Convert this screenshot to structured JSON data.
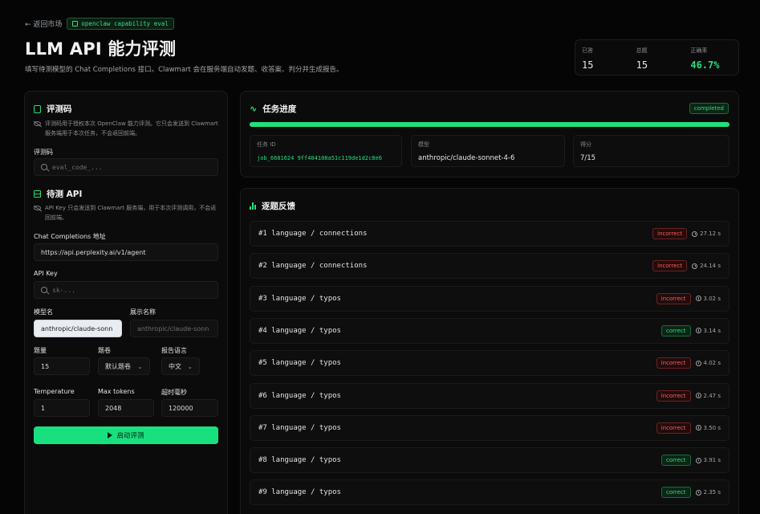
{
  "header": {
    "back_label": "← 返回市场",
    "tag_label": "openclaw capability eval",
    "title": "LLM API 能力评测",
    "description": "填写待测模型的 Chat Completions 接口。Clawmart 会在服务端自动发题、收答案、判分并生成报告。"
  },
  "stats": [
    {
      "label": "已答",
      "value": "15"
    },
    {
      "label": "总题",
      "value": "15"
    },
    {
      "label": "正确率",
      "value": "46.7%"
    }
  ],
  "left": {
    "eval_section": {
      "title": "评测码",
      "note": "评测码用于授权本次 OpenClaw 能力评测。它只会发送到 Clawmart 服务端用于本次任务，不会返回前端。",
      "code_label": "评测码",
      "code_placeholder": "eval_code_..."
    },
    "api_section": {
      "title": "待测 API",
      "note": "API Key 只会发送到 Clawmart 服务端，用于本次评测调用，不会返回前端。",
      "endpoint_label": "Chat Completions 地址",
      "endpoint_value": "https://api.perplexity.ai/v1/agent",
      "key_label": "API Key",
      "key_placeholder": "sk-...",
      "model_label": "模型名",
      "model_value": "anthropic/claude-sonn",
      "display_label": "展示名称",
      "display_placeholder": "anthropic/claude-sonn",
      "count_label": "题量",
      "count_value": "15",
      "set_label": "题卷",
      "set_value": "默认题卷",
      "lang_label": "报告语言",
      "lang_value": "中文",
      "temp_label": "Temperature",
      "temp_value": "1",
      "tokens_label": "Max tokens",
      "tokens_value": "2048",
      "timeout_label": "超时毫秒",
      "timeout_value": "120000",
      "run_label": "启动评测"
    }
  },
  "progress": {
    "title": "任务进度",
    "status": "completed",
    "fraction": 1.0,
    "job_label": "任务 ID",
    "job_value": "job_6681624 9ff404108a51c119de1d2c8e6",
    "model_label": "模型",
    "model_value": "anthropic/claude-sonnet-4-6",
    "score_label": "得分",
    "score_value": "7/15"
  },
  "feedback": {
    "title": "逐题反馈",
    "rows": [
      {
        "q": "#1 language / connections",
        "result": "incorrect",
        "time": "27.12 s"
      },
      {
        "q": "#2 language / connections",
        "result": "incorrect",
        "time": "24.14 s"
      },
      {
        "q": "#3 language / typos",
        "result": "incorrect",
        "time": "3.02 s"
      },
      {
        "q": "#4 language / typos",
        "result": "correct",
        "time": "3.14 s"
      },
      {
        "q": "#5 language / typos",
        "result": "incorrect",
        "time": "4.02 s"
      },
      {
        "q": "#6 language / typos",
        "result": "incorrect",
        "time": "2.47 s"
      },
      {
        "q": "#7 language / typos",
        "result": "incorrect",
        "time": "3.50 s"
      },
      {
        "q": "#8 language / typos",
        "result": "correct",
        "time": "3.91 s"
      },
      {
        "q": "#9 language / typos",
        "result": "correct",
        "time": "2.35 s"
      }
    ]
  },
  "colors": {
    "accent": "#22e07a",
    "error": "#ff5a5a",
    "background": "#050505"
  }
}
